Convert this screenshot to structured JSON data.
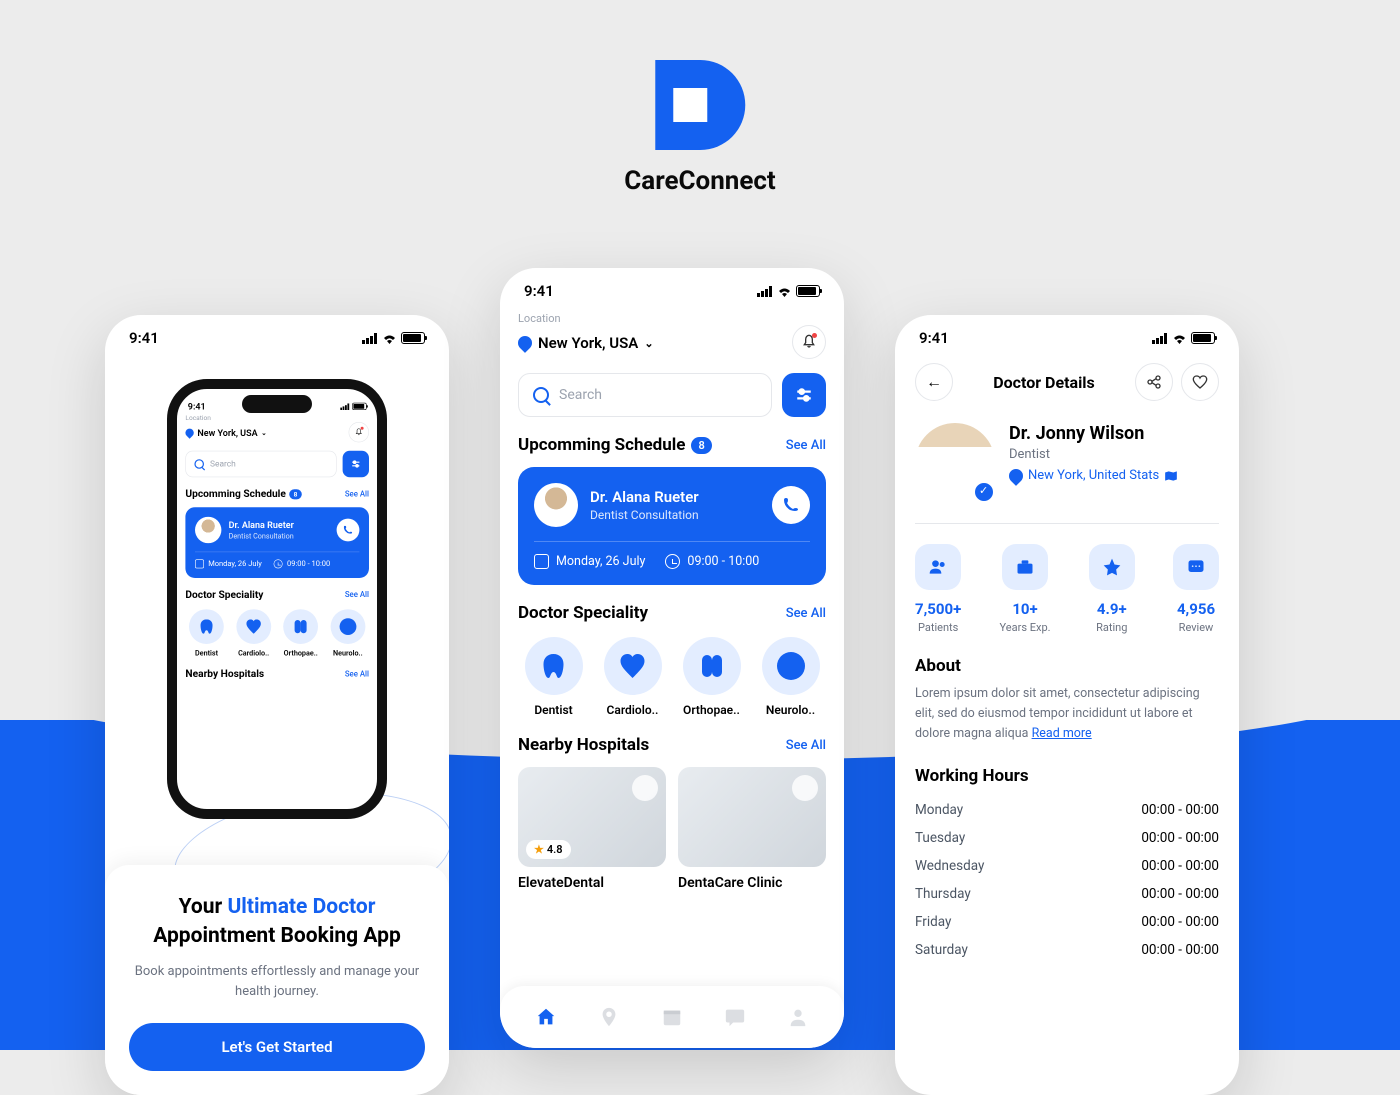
{
  "brand": {
    "name": "CareConnect"
  },
  "status": {
    "time": "9:41"
  },
  "onboarding": {
    "title_part1": "Your ",
    "title_blue": "Ultimate Doctor",
    "title_part2": "Appointment Booking App",
    "subtitle": "Book appointments effortlessly and manage your health journey.",
    "cta": "Let's Get Started"
  },
  "home": {
    "location_label": "Location",
    "location_value": "New York, USA",
    "search_placeholder": "Search",
    "schedule_title": "Upcomming Schedule",
    "schedule_count": "8",
    "see_all": "See All",
    "appointment": {
      "doctor": "Dr. Alana Rueter",
      "role": "Dentist Consultation",
      "date": "Monday, 26 July",
      "time": "09:00 - 10:00"
    },
    "speciality_title": "Doctor Speciality",
    "specialities": [
      {
        "label": "Dentist"
      },
      {
        "label": "Cardiolo.."
      },
      {
        "label": "Orthopae.."
      },
      {
        "label": "Neurolo.."
      }
    ],
    "nearby_title": "Nearby Hospitals",
    "hospitals": [
      {
        "name": "ElevateDental",
        "rating": "4.8"
      },
      {
        "name": "DentaCare Clinic",
        "rating": ""
      }
    ]
  },
  "details": {
    "nav_title": "Doctor Details",
    "doctor_name": "Dr. Jonny Wilson",
    "doctor_role": "Dentist",
    "doctor_location": "New York, United Stats",
    "stats": [
      {
        "value": "7,500+",
        "label": "Patients"
      },
      {
        "value": "10+",
        "label": "Years Exp."
      },
      {
        "value": "4.9+",
        "label": "Rating"
      },
      {
        "value": "4,956",
        "label": "Review"
      }
    ],
    "about_title": "About",
    "about_text": "Lorem ipsum dolor sit amet, consectetur adipiscing elit, sed do eiusmod tempor incididunt ut labore et dolore magna aliqua ",
    "read_more": "Read more",
    "hours_title": "Working Hours",
    "hours": [
      {
        "day": "Monday",
        "time": "00:00 - 00:00"
      },
      {
        "day": "Tuesday",
        "time": "00:00 - 00:00"
      },
      {
        "day": "Wednesday",
        "time": "00:00 - 00:00"
      },
      {
        "day": "Thursday",
        "time": "00:00 - 00:00"
      },
      {
        "day": "Friday",
        "time": "00:00 - 00:00"
      },
      {
        "day": "Saturday",
        "time": "00:00 - 00:00"
      }
    ]
  }
}
